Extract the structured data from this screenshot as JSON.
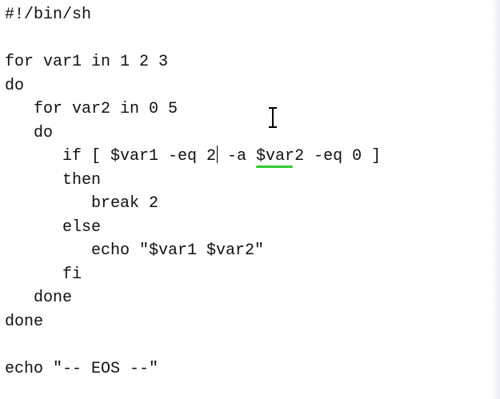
{
  "editor": {
    "lines": [
      "#!/bin/sh",
      "",
      "for var1 in 1 2 3",
      "do",
      "   for var2 in 0 5",
      "   do",
      "      if [ $var1 -eq 2",
      "      then",
      "         break 2",
      "      else",
      "         echo \"$var1 $var2\"",
      "      fi",
      "   done",
      "done",
      "",
      "echo \"-- EOS --\""
    ],
    "line7_after_caret": " -a $var2 -eq 0 ]"
  },
  "colors": {
    "text": "#101010",
    "highlight_underline": "#2ecc2e",
    "background": "#ffffff"
  },
  "cursor_icon": "i-beam-cursor-icon"
}
